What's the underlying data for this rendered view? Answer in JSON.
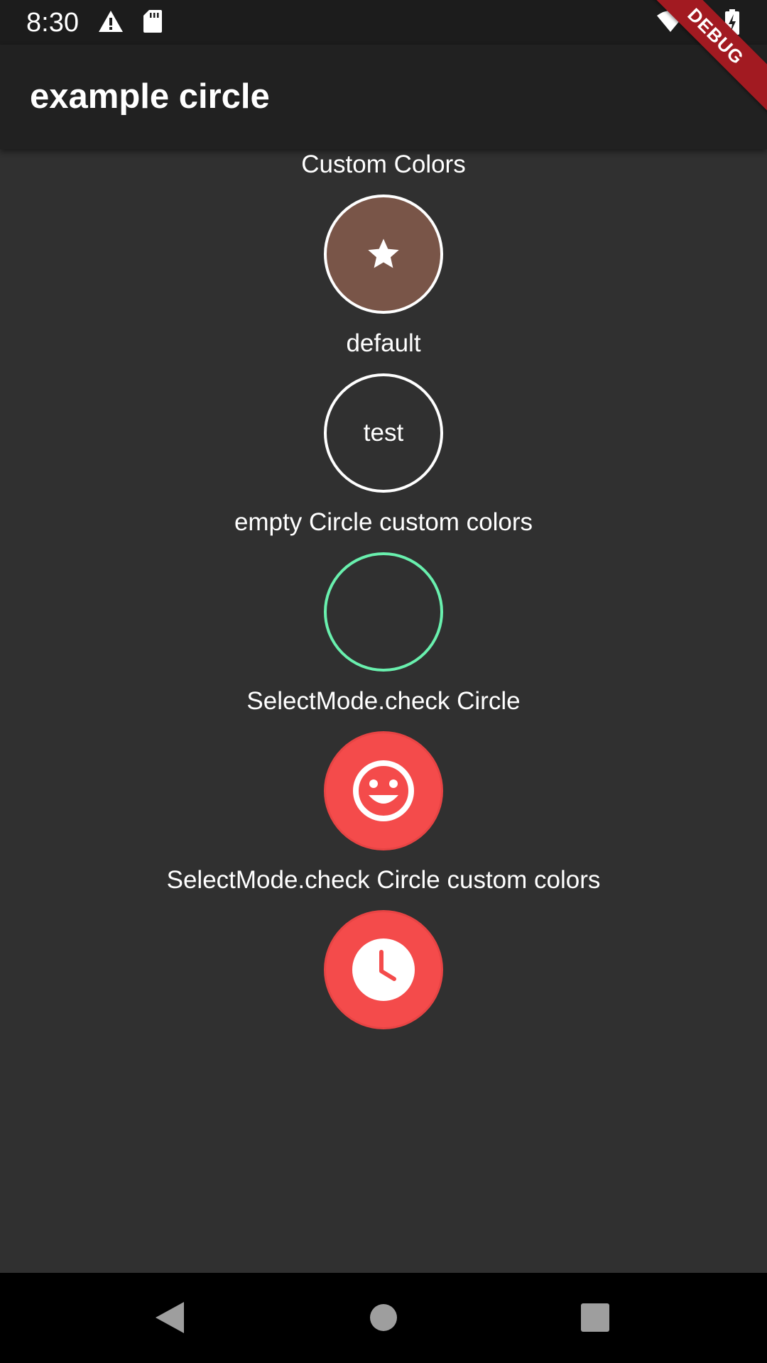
{
  "status_bar": {
    "time": "8:30",
    "icons": [
      "warning-icon",
      "sd-card-icon",
      "wifi-icon",
      "cell-signal-icon",
      "battery-charging-icon"
    ]
  },
  "app_bar": {
    "title": "example circle"
  },
  "debug_banner": {
    "label": "DEBUG",
    "color": "#a21a21"
  },
  "sections": [
    {
      "label": "Custom Colors",
      "circle": {
        "fill": "#795548",
        "border": "#ffffff",
        "icon": "star-icon"
      }
    },
    {
      "label": "default",
      "circle": {
        "fill": "transparent",
        "border": "#ffffff",
        "text": "test"
      }
    },
    {
      "label": "empty Circle custom colors",
      "circle": {
        "fill": "transparent",
        "border": "#69f0ae"
      }
    },
    {
      "label": "SelectMode.check Circle",
      "circle": {
        "fill": "#f44b4b",
        "border": "#f44b4b",
        "icon": "smiley-face-icon"
      }
    },
    {
      "label": "SelectMode.check Circle custom colors",
      "circle": {
        "fill": "#f44b4b",
        "border": "#f44b4b",
        "icon": "clock-icon"
      }
    }
  ],
  "nav_bar": {
    "buttons": [
      "back-icon",
      "home-icon",
      "recents-icon"
    ]
  }
}
